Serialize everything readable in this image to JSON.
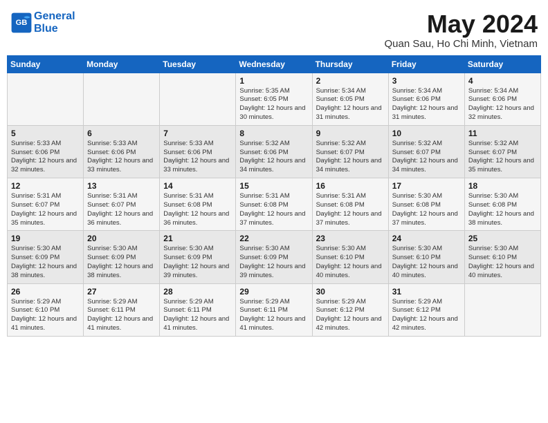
{
  "header": {
    "logo_line1": "General",
    "logo_line2": "Blue",
    "month": "May 2024",
    "location": "Quan Sau, Ho Chi Minh, Vietnam"
  },
  "weekdays": [
    "Sunday",
    "Monday",
    "Tuesday",
    "Wednesday",
    "Thursday",
    "Friday",
    "Saturday"
  ],
  "weeks": [
    [
      {
        "day": "",
        "info": ""
      },
      {
        "day": "",
        "info": ""
      },
      {
        "day": "",
        "info": ""
      },
      {
        "day": "1",
        "info": "Sunrise: 5:35 AM\nSunset: 6:05 PM\nDaylight: 12 hours\nand 30 minutes."
      },
      {
        "day": "2",
        "info": "Sunrise: 5:34 AM\nSunset: 6:05 PM\nDaylight: 12 hours\nand 31 minutes."
      },
      {
        "day": "3",
        "info": "Sunrise: 5:34 AM\nSunset: 6:06 PM\nDaylight: 12 hours\nand 31 minutes."
      },
      {
        "day": "4",
        "info": "Sunrise: 5:34 AM\nSunset: 6:06 PM\nDaylight: 12 hours\nand 32 minutes."
      }
    ],
    [
      {
        "day": "5",
        "info": "Sunrise: 5:33 AM\nSunset: 6:06 PM\nDaylight: 12 hours\nand 32 minutes."
      },
      {
        "day": "6",
        "info": "Sunrise: 5:33 AM\nSunset: 6:06 PM\nDaylight: 12 hours\nand 33 minutes."
      },
      {
        "day": "7",
        "info": "Sunrise: 5:33 AM\nSunset: 6:06 PM\nDaylight: 12 hours\nand 33 minutes."
      },
      {
        "day": "8",
        "info": "Sunrise: 5:32 AM\nSunset: 6:06 PM\nDaylight: 12 hours\nand 34 minutes."
      },
      {
        "day": "9",
        "info": "Sunrise: 5:32 AM\nSunset: 6:07 PM\nDaylight: 12 hours\nand 34 minutes."
      },
      {
        "day": "10",
        "info": "Sunrise: 5:32 AM\nSunset: 6:07 PM\nDaylight: 12 hours\nand 34 minutes."
      },
      {
        "day": "11",
        "info": "Sunrise: 5:32 AM\nSunset: 6:07 PM\nDaylight: 12 hours\nand 35 minutes."
      }
    ],
    [
      {
        "day": "12",
        "info": "Sunrise: 5:31 AM\nSunset: 6:07 PM\nDaylight: 12 hours\nand 35 minutes."
      },
      {
        "day": "13",
        "info": "Sunrise: 5:31 AM\nSunset: 6:07 PM\nDaylight: 12 hours\nand 36 minutes."
      },
      {
        "day": "14",
        "info": "Sunrise: 5:31 AM\nSunset: 6:08 PM\nDaylight: 12 hours\nand 36 minutes."
      },
      {
        "day": "15",
        "info": "Sunrise: 5:31 AM\nSunset: 6:08 PM\nDaylight: 12 hours\nand 37 minutes."
      },
      {
        "day": "16",
        "info": "Sunrise: 5:31 AM\nSunset: 6:08 PM\nDaylight: 12 hours\nand 37 minutes."
      },
      {
        "day": "17",
        "info": "Sunrise: 5:30 AM\nSunset: 6:08 PM\nDaylight: 12 hours\nand 37 minutes."
      },
      {
        "day": "18",
        "info": "Sunrise: 5:30 AM\nSunset: 6:08 PM\nDaylight: 12 hours\nand 38 minutes."
      }
    ],
    [
      {
        "day": "19",
        "info": "Sunrise: 5:30 AM\nSunset: 6:09 PM\nDaylight: 12 hours\nand 38 minutes."
      },
      {
        "day": "20",
        "info": "Sunrise: 5:30 AM\nSunset: 6:09 PM\nDaylight: 12 hours\nand 38 minutes."
      },
      {
        "day": "21",
        "info": "Sunrise: 5:30 AM\nSunset: 6:09 PM\nDaylight: 12 hours\nand 39 minutes."
      },
      {
        "day": "22",
        "info": "Sunrise: 5:30 AM\nSunset: 6:09 PM\nDaylight: 12 hours\nand 39 minutes."
      },
      {
        "day": "23",
        "info": "Sunrise: 5:30 AM\nSunset: 6:10 PM\nDaylight: 12 hours\nand 40 minutes."
      },
      {
        "day": "24",
        "info": "Sunrise: 5:30 AM\nSunset: 6:10 PM\nDaylight: 12 hours\nand 40 minutes."
      },
      {
        "day": "25",
        "info": "Sunrise: 5:30 AM\nSunset: 6:10 PM\nDaylight: 12 hours\nand 40 minutes."
      }
    ],
    [
      {
        "day": "26",
        "info": "Sunrise: 5:29 AM\nSunset: 6:10 PM\nDaylight: 12 hours\nand 41 minutes."
      },
      {
        "day": "27",
        "info": "Sunrise: 5:29 AM\nSunset: 6:11 PM\nDaylight: 12 hours\nand 41 minutes."
      },
      {
        "day": "28",
        "info": "Sunrise: 5:29 AM\nSunset: 6:11 PM\nDaylight: 12 hours\nand 41 minutes."
      },
      {
        "day": "29",
        "info": "Sunrise: 5:29 AM\nSunset: 6:11 PM\nDaylight: 12 hours\nand 41 minutes."
      },
      {
        "day": "30",
        "info": "Sunrise: 5:29 AM\nSunset: 6:12 PM\nDaylight: 12 hours\nand 42 minutes."
      },
      {
        "day": "31",
        "info": "Sunrise: 5:29 AM\nSunset: 6:12 PM\nDaylight: 12 hours\nand 42 minutes."
      },
      {
        "day": "",
        "info": ""
      }
    ]
  ]
}
